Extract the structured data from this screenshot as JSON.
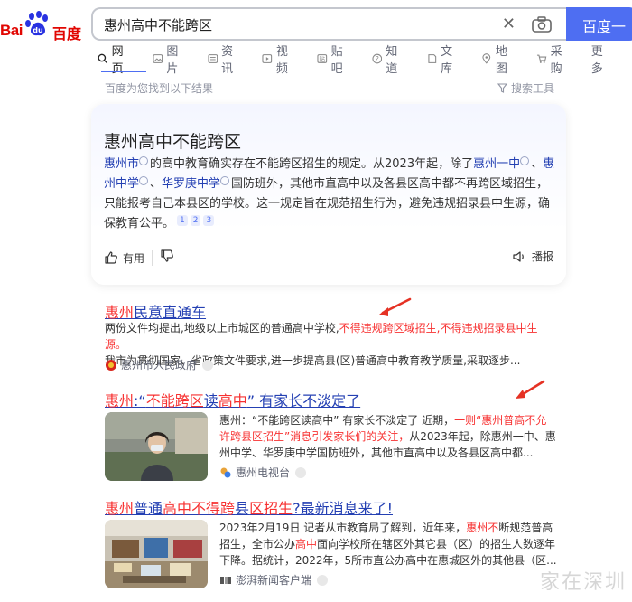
{
  "header": {
    "logo_bai": "Bai",
    "logo_du": "百度",
    "query": "惠州高中不能跨区",
    "search_button": "百度一下"
  },
  "tabs": [
    {
      "label": "网页",
      "icon": "search-icon"
    },
    {
      "label": "图片",
      "icon": "image-icon"
    },
    {
      "label": "资讯",
      "icon": "news-icon"
    },
    {
      "label": "视频",
      "icon": "video-icon"
    },
    {
      "label": "贴吧",
      "icon": "tieba-icon"
    },
    {
      "label": "知道",
      "icon": "question-icon"
    },
    {
      "label": "文库",
      "icon": "doc-icon"
    },
    {
      "label": "地图",
      "icon": "map-pin-icon"
    },
    {
      "label": "采购",
      "icon": "cart-icon"
    },
    {
      "label": "更多",
      "icon": ""
    }
  ],
  "result_count": "百度为您找到以下结果",
  "tools_label": "搜索工具",
  "ai_card": {
    "title": "惠州高中不能跨区",
    "p1_link": "惠州市",
    "p1_a": "的高中教育确实存在不能跨区招生的规定。从2023年起，除了",
    "p1_link2": "惠州一中",
    "p1_b": "、",
    "p1_link3": "惠州中学",
    "p1_c": "、",
    "p1_link4": "华罗庚中学",
    "p1_d": "国防班外，其他市直高中以及各县区高中都不再跨区域招生，只能报考自己本县区的学校。这一规定旨在规范招生行为，避免违规招录县中生源，确保教育公平。",
    "refs": [
      "1",
      "2",
      "3"
    ],
    "useful": "有用",
    "broadcast": "播报"
  },
  "results": [
    {
      "title_hl": "惠州",
      "title_rest": "民意直通车",
      "text_a": "两份文件均提出,地级以上市城区的普通高中学校,",
      "text_hl": "不得违规跨区域招生,不得违规招录县中生源。",
      "text_b": "我市为贯彻国家、省政策文件要求,进一步提高县(区)普通高中教育教学质量,采取逐步...",
      "source": "惠州市人民政府"
    },
    {
      "title_hl": "惠州",
      "title_mid": ":“",
      "title_hl2": "不能跨区",
      "title_mid2": "读",
      "title_hl3": "高中",
      "title_rest": "” 有家长不淡定了",
      "text_a": "惠州：“不能跨区读高中” 有家长不淡定了 近期，",
      "text_hl": "一则“惠州普高不允许跨县区招生”消息引发家长们的关注，",
      "text_b": "从2023年起，除惠州一中、惠州中学、华罗庚中学国防班外，其他市直高中以及各县区高中都...",
      "source": "惠州电视台"
    },
    {
      "title_hl": "惠州",
      "title_mid": "普通",
      "title_hl2": "高中不得跨",
      "title_mid2": "县",
      "title_hl3": "区招生",
      "title_rest": "?最新消息来了!",
      "text_a": "2023年2月19日 记者从市教育局了解到，近年来，",
      "text_hl": "惠州不",
      "text_b": "断规范普高招生，全市公办",
      "text_hl2": "高中",
      "text_c": "面向学校所在辖区外其它县（区）的招生人数逐年下降。据统计，2022年，5所市直公办高中在惠城区外的其他县（区...",
      "source": "澎湃新闻客户端"
    }
  ],
  "watermark": "家在深圳"
}
